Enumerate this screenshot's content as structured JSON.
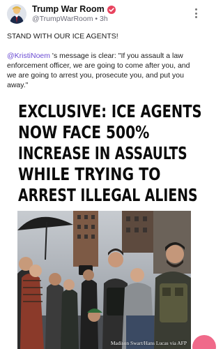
{
  "post": {
    "display_name": "Trump War Room",
    "handle": "@TrumpWarRoom",
    "separator": "•",
    "time_ago": "3h",
    "line1": "STAND WITH OUR ICE AGENTS!",
    "mention": "@KristiNoem",
    "quote_text": " 's message is clear: \"If you assault a law enforcement officer, we are going to come after you, and we are going to arrest you, prosecute you, and put you away.\""
  },
  "media": {
    "headline_lines": [
      "EXCLUSIVE: ICE AGENTS",
      "NOW FACE 500%",
      "INCREASE IN ASSAULTS",
      "WHILE TRYING TO",
      "ARREST ILLEGAL ALIENS"
    ],
    "photo_credit": "Madison Swart/Hans Lucas via AFP"
  },
  "colors": {
    "accent": "#6a4bd3",
    "verified_badge": "#e8435e",
    "fab": "#f06a8a"
  },
  "icons": {
    "verified": "verified-badge-icon",
    "more": "more-vertical-icon"
  }
}
